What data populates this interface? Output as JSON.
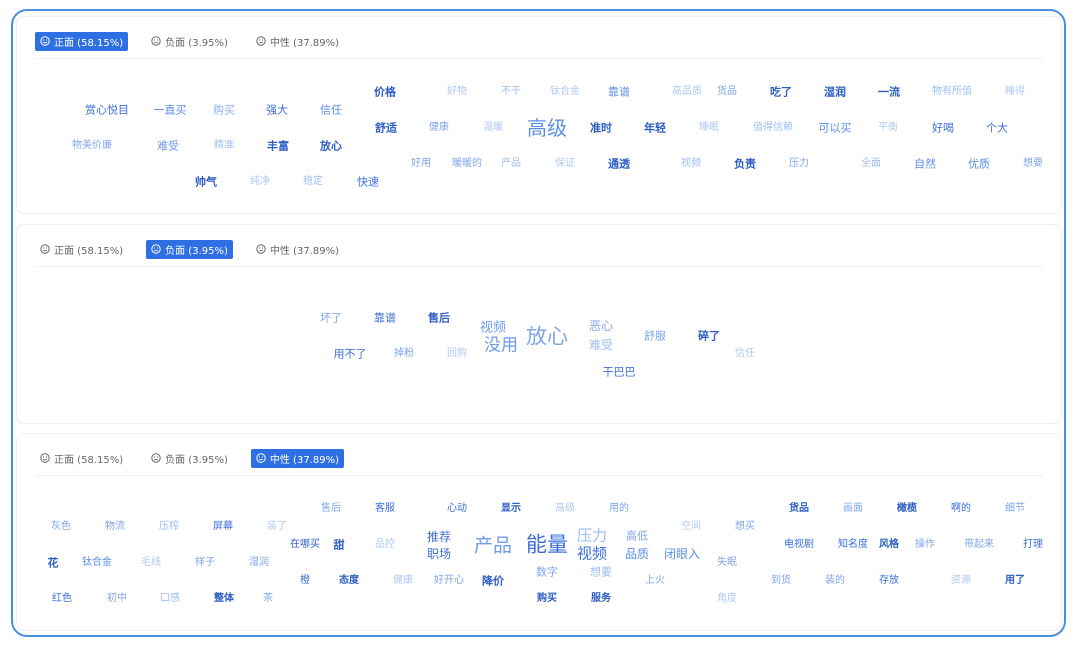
{
  "tabs": {
    "positive": "正面 (58.15%)",
    "negative": "负面 (3.95%)",
    "neutral": "中性 (37.89%)"
  },
  "colors": {
    "accent": "#2f6fe4",
    "border": "#4a90e2"
  },
  "panels": [
    {
      "active_tab": "positive",
      "words": [
        {
          "t": "赏心悦目",
          "s": 11,
          "c": "#3d6fd8",
          "w": 500
        },
        {
          "t": "一直买",
          "s": 11,
          "c": "#5b8fe6",
          "w": 400
        },
        {
          "t": "购买",
          "s": 11,
          "c": "#8ab0ee",
          "w": 400
        },
        {
          "t": "强大",
          "s": 11,
          "c": "#3d6fd8",
          "w": 500
        },
        {
          "t": "信任",
          "s": 11,
          "c": "#5b8fe6",
          "w": 400
        },
        {
          "t": "物美价廉",
          "s": 10,
          "c": "#7fa6ec",
          "w": 400
        },
        {
          "t": "难受",
          "s": 11,
          "c": "#6d9be8",
          "w": 400
        },
        {
          "t": "精准",
          "s": 10,
          "c": "#9dbcf1",
          "w": 400
        },
        {
          "t": "丰富",
          "s": 11,
          "c": "#2f5fc4",
          "w": 600
        },
        {
          "t": "放心",
          "s": 11,
          "c": "#2f5fc4",
          "w": 600
        },
        {
          "t": "帅气",
          "s": 11,
          "c": "#2f5fc4",
          "w": 600
        },
        {
          "t": "纯净",
          "s": 10,
          "c": "#b0c8f3",
          "w": 400
        },
        {
          "t": "稳定",
          "s": 10,
          "c": "#9dbcf1",
          "w": 400
        },
        {
          "t": "快速",
          "s": 11,
          "c": "#3d6fd8",
          "w": 500
        },
        {
          "t": "价格",
          "s": 11,
          "c": "#2f5fc4",
          "w": 600
        },
        {
          "t": "好物",
          "s": 10,
          "c": "#b0c8f3",
          "w": 400
        },
        {
          "t": "不干",
          "s": 10,
          "c": "#9dbcf1",
          "w": 400
        },
        {
          "t": "钛合金",
          "s": 10,
          "c": "#b0c8f3",
          "w": 400
        },
        {
          "t": "靠谱",
          "s": 11,
          "c": "#5b8fe6",
          "w": 400
        },
        {
          "t": "高品质",
          "s": 10,
          "c": "#b0c8f3",
          "w": 400
        },
        {
          "t": "货品",
          "s": 10,
          "c": "#7fa6ec",
          "w": 400
        },
        {
          "t": "吃了",
          "s": 11,
          "c": "#2f5fc4",
          "w": 600
        },
        {
          "t": "湿润",
          "s": 11,
          "c": "#2f5fc4",
          "w": 600
        },
        {
          "t": "一流",
          "s": 11,
          "c": "#2f5fc4",
          "w": 600
        },
        {
          "t": "物有所值",
          "s": 10,
          "c": "#9dbcf1",
          "w": 400
        },
        {
          "t": "睡得",
          "s": 10,
          "c": "#b0c8f3",
          "w": 400
        },
        {
          "t": "舒适",
          "s": 11,
          "c": "#2f5fc4",
          "w": 600
        },
        {
          "t": "健康",
          "s": 10,
          "c": "#7fa6ec",
          "w": 400
        },
        {
          "t": "温暖",
          "s": 10,
          "c": "#b0c8f3",
          "w": 400
        },
        {
          "t": "高级",
          "s": 20,
          "c": "#5b8fe6",
          "w": 500
        },
        {
          "t": "准时",
          "s": 11,
          "c": "#2f5fc4",
          "w": 600
        },
        {
          "t": "年轻",
          "s": 11,
          "c": "#2f5fc4",
          "w": 600
        },
        {
          "t": "睡眠",
          "s": 10,
          "c": "#b0c8f3",
          "w": 400
        },
        {
          "t": "值得信赖",
          "s": 10,
          "c": "#9dbcf1",
          "w": 400
        },
        {
          "t": "可以买",
          "s": 11,
          "c": "#5b8fe6",
          "w": 400
        },
        {
          "t": "平衡",
          "s": 10,
          "c": "#b0c8f3",
          "w": 400
        },
        {
          "t": "好喝",
          "s": 11,
          "c": "#3d6fd8",
          "w": 500
        },
        {
          "t": "个大",
          "s": 11,
          "c": "#3d6fd8",
          "w": 500
        },
        {
          "t": "好用",
          "s": 10,
          "c": "#7fa6ec",
          "w": 400
        },
        {
          "t": "暖暖的",
          "s": 10,
          "c": "#7fa6ec",
          "w": 400
        },
        {
          "t": "产品",
          "s": 10,
          "c": "#9dbcf1",
          "w": 400
        },
        {
          "t": "保证",
          "s": 10,
          "c": "#b0c8f3",
          "w": 400
        },
        {
          "t": "通透",
          "s": 11,
          "c": "#2f5fc4",
          "w": 600
        },
        {
          "t": "视频",
          "s": 10,
          "c": "#9dbcf1",
          "w": 400
        },
        {
          "t": "负责",
          "s": 11,
          "c": "#2f5fc4",
          "w": 600
        },
        {
          "t": "压力",
          "s": 10,
          "c": "#7fa6ec",
          "w": 400
        },
        {
          "t": "全面",
          "s": 10,
          "c": "#9dbcf1",
          "w": 400
        },
        {
          "t": "自然",
          "s": 11,
          "c": "#5b8fe6",
          "w": 500
        },
        {
          "t": "优质",
          "s": 11,
          "c": "#5b8fe6",
          "w": 500
        },
        {
          "t": "想要",
          "s": 10,
          "c": "#7fa6ec",
          "w": 400
        }
      ]
    },
    {
      "active_tab": "negative",
      "words": [
        {
          "t": "坏了",
          "s": 11,
          "c": "#7fa6ec",
          "w": 400
        },
        {
          "t": "靠谱",
          "s": 11,
          "c": "#3d6fd8",
          "w": 500
        },
        {
          "t": "售后",
          "s": 11,
          "c": "#2f5fc4",
          "w": 600
        },
        {
          "t": "视频",
          "s": 13,
          "c": "#6d9be8",
          "w": 400
        },
        {
          "t": "没用",
          "s": 17,
          "c": "#6d9be8",
          "w": 400
        },
        {
          "t": "放心",
          "s": 21,
          "c": "#7fa6ec",
          "w": 400
        },
        {
          "t": "恶心",
          "s": 12,
          "c": "#7fa6ec",
          "w": 400
        },
        {
          "t": "难受",
          "s": 12,
          "c": "#9dbcf1",
          "w": 400
        },
        {
          "t": "舒服",
          "s": 11,
          "c": "#7fa6ec",
          "w": 400
        },
        {
          "t": "碎了",
          "s": 11,
          "c": "#2f5fc4",
          "w": 600
        },
        {
          "t": "用不了",
          "s": 11,
          "c": "#3d6fd8",
          "w": 500
        },
        {
          "t": "掉粉",
          "s": 10,
          "c": "#7fa6ec",
          "w": 400
        },
        {
          "t": "回购",
          "s": 10,
          "c": "#b0c8f3",
          "w": 400
        },
        {
          "t": "信任",
          "s": 10,
          "c": "#b0c8f3",
          "w": 400
        },
        {
          "t": "干巴巴",
          "s": 11,
          "c": "#3d6fd8",
          "w": 500
        }
      ]
    },
    {
      "active_tab": "neutral",
      "words": [
        {
          "t": "灰色",
          "s": 10,
          "c": "#7fa6ec",
          "w": 400
        },
        {
          "t": "物流",
          "s": 10,
          "c": "#7fa6ec",
          "w": 400
        },
        {
          "t": "压榨",
          "s": 10,
          "c": "#9dbcf1",
          "w": 400
        },
        {
          "t": "屏幕",
          "s": 10,
          "c": "#3d6fd8",
          "w": 500
        },
        {
          "t": "装了",
          "s": 10,
          "c": "#b0c8f3",
          "w": 400
        },
        {
          "t": "售后",
          "s": 10,
          "c": "#7fa6ec",
          "w": 400
        },
        {
          "t": "客服",
          "s": 10,
          "c": "#3d6fd8",
          "w": 500
        },
        {
          "t": "心动",
          "s": 10,
          "c": "#3d6fd8",
          "w": 500
        },
        {
          "t": "显示",
          "s": 10,
          "c": "#2f5fc4",
          "w": 600
        },
        {
          "t": "高级",
          "s": 10,
          "c": "#b0c8f3",
          "w": 400
        },
        {
          "t": "用的",
          "s": 10,
          "c": "#7fa6ec",
          "w": 400
        },
        {
          "t": "空间",
          "s": 10,
          "c": "#b0c8f3",
          "w": 400
        },
        {
          "t": "想买",
          "s": 10,
          "c": "#7fa6ec",
          "w": 400
        },
        {
          "t": "货品",
          "s": 10,
          "c": "#2f5fc4",
          "w": 600
        },
        {
          "t": "画面",
          "s": 10,
          "c": "#7fa6ec",
          "w": 400
        },
        {
          "t": "橄榄",
          "s": 10,
          "c": "#2f5fc4",
          "w": 600
        },
        {
          "t": "啊的",
          "s": 10,
          "c": "#3d6fd8",
          "w": 500
        },
        {
          "t": "细节",
          "s": 10,
          "c": "#7fa6ec",
          "w": 400
        },
        {
          "t": "花",
          "s": 11,
          "c": "#2f5fc4",
          "w": 600
        },
        {
          "t": "钛合金",
          "s": 10,
          "c": "#5b8fe6",
          "w": 400
        },
        {
          "t": "毛线",
          "s": 10,
          "c": "#b0c8f3",
          "w": 400
        },
        {
          "t": "样子",
          "s": 10,
          "c": "#7fa6ec",
          "w": 400
        },
        {
          "t": "湿润",
          "s": 10,
          "c": "#7fa6ec",
          "w": 400
        },
        {
          "t": "在哪买",
          "s": 10,
          "c": "#2f5fc4",
          "w": 500
        },
        {
          "t": "甜",
          "s": 11,
          "c": "#2f5fc4",
          "w": 600
        },
        {
          "t": "品控",
          "s": 10,
          "c": "#b0c8f3",
          "w": 400
        },
        {
          "t": "推荐",
          "s": 12,
          "c": "#3d6fd8",
          "w": 500
        },
        {
          "t": "职场",
          "s": 12,
          "c": "#3d6fd8",
          "w": 500
        },
        {
          "t": "产品",
          "s": 19,
          "c": "#6d9be8",
          "w": 400
        },
        {
          "t": "能量",
          "s": 21,
          "c": "#3d6fd8",
          "w": 500
        },
        {
          "t": "压力",
          "s": 15,
          "c": "#9dbcf1",
          "w": 400
        },
        {
          "t": "视频",
          "s": 15,
          "c": "#3d6fd8",
          "w": 500
        },
        {
          "t": "高低",
          "s": 11,
          "c": "#7fa6ec",
          "w": 400
        },
        {
          "t": "品质",
          "s": 12,
          "c": "#5b8fe6",
          "w": 400
        },
        {
          "t": "闭眼入",
          "s": 12,
          "c": "#5b8fe6",
          "w": 400
        },
        {
          "t": "失眠",
          "s": 10,
          "c": "#7fa6ec",
          "w": 400
        },
        {
          "t": "电视剧",
          "s": 10,
          "c": "#3d6fd8",
          "w": 500
        },
        {
          "t": "知名度",
          "s": 10,
          "c": "#3d6fd8",
          "w": 500
        },
        {
          "t": "风格",
          "s": 10,
          "c": "#2f5fc4",
          "w": 600
        },
        {
          "t": "操作",
          "s": 10,
          "c": "#7fa6ec",
          "w": 400
        },
        {
          "t": "带起来",
          "s": 10,
          "c": "#7fa6ec",
          "w": 400
        },
        {
          "t": "打理",
          "s": 10,
          "c": "#3d6fd8",
          "w": 500
        },
        {
          "t": "橙",
          "s": 10,
          "c": "#3d6fd8",
          "w": 500
        },
        {
          "t": "态度",
          "s": 10,
          "c": "#2f5fc4",
          "w": 600
        },
        {
          "t": "健康",
          "s": 10,
          "c": "#b0c8f3",
          "w": 400
        },
        {
          "t": "好开心",
          "s": 10,
          "c": "#7fa6ec",
          "w": 400
        },
        {
          "t": "降价",
          "s": 11,
          "c": "#2f5fc4",
          "w": 600
        },
        {
          "t": "数字",
          "s": 11,
          "c": "#7fa6ec",
          "w": 400
        },
        {
          "t": "想要",
          "s": 11,
          "c": "#9dbcf1",
          "w": 400
        },
        {
          "t": "上火",
          "s": 10,
          "c": "#7fa6ec",
          "w": 400
        },
        {
          "t": "到货",
          "s": 10,
          "c": "#7fa6ec",
          "w": 400
        },
        {
          "t": "装的",
          "s": 10,
          "c": "#7fa6ec",
          "w": 400
        },
        {
          "t": "存放",
          "s": 10,
          "c": "#3d6fd8",
          "w": 500
        },
        {
          "t": "资源",
          "s": 10,
          "c": "#b0c8f3",
          "w": 400
        },
        {
          "t": "用了",
          "s": 10,
          "c": "#2f5fc4",
          "w": 600
        },
        {
          "t": "红色",
          "s": 10,
          "c": "#3d6fd8",
          "w": 500
        },
        {
          "t": "初中",
          "s": 10,
          "c": "#7fa6ec",
          "w": 400
        },
        {
          "t": "口感",
          "s": 10,
          "c": "#9dbcf1",
          "w": 400
        },
        {
          "t": "整体",
          "s": 10,
          "c": "#2f5fc4",
          "w": 600
        },
        {
          "t": "茶",
          "s": 10,
          "c": "#7fa6ec",
          "w": 400
        },
        {
          "t": "购买",
          "s": 10,
          "c": "#2f5fc4",
          "w": 600
        },
        {
          "t": "服务",
          "s": 10,
          "c": "#2f5fc4",
          "w": 600
        },
        {
          "t": "角度",
          "s": 10,
          "c": "#b0c8f3",
          "w": 400
        }
      ]
    }
  ]
}
